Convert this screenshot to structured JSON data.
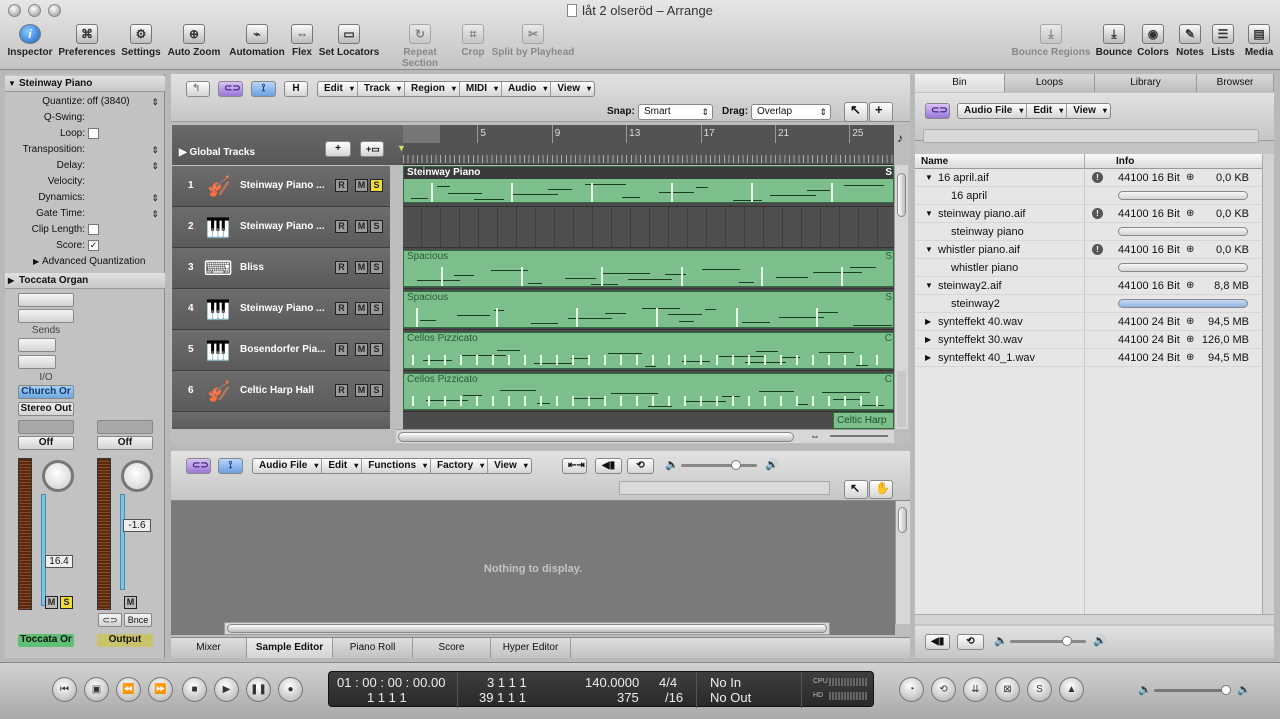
{
  "window": {
    "title": "låt 2 olseröd – Arrange"
  },
  "toolbar": {
    "left": [
      {
        "label": "Inspector",
        "icon": "info-icon"
      },
      {
        "label": "Preferences",
        "icon": "preferences-icon"
      },
      {
        "label": "Settings",
        "icon": "settings-icon"
      },
      {
        "label": "Auto Zoom",
        "icon": "zoom-icon"
      },
      {
        "label": "Automation",
        "icon": "automation-icon"
      },
      {
        "label": "Flex",
        "icon": "flex-icon"
      },
      {
        "label": "Set Locators",
        "icon": "locators-icon"
      },
      {
        "label": "Repeat Section",
        "icon": "repeat-icon"
      },
      {
        "label": "Crop",
        "icon": "crop-icon"
      },
      {
        "label": "Split by Playhead",
        "icon": "split-icon"
      }
    ],
    "right": [
      {
        "label": "Bounce Regions",
        "icon": "bounce-regions-icon"
      },
      {
        "label": "Bounce",
        "icon": "bounce-icon"
      },
      {
        "label": "Colors",
        "icon": "colors-icon"
      },
      {
        "label": "Notes",
        "icon": "notes-icon"
      },
      {
        "label": "Lists",
        "icon": "lists-icon"
      },
      {
        "label": "Media",
        "icon": "media-icon"
      }
    ]
  },
  "inspector": {
    "region_header": "Steinway Piano",
    "params": [
      {
        "key": "Quantize:",
        "value": "off (3840)"
      },
      {
        "key": "Q-Swing:",
        "value": ""
      },
      {
        "key": "Loop:",
        "value": ""
      },
      {
        "key": "Transposition:",
        "value": ""
      },
      {
        "key": "Delay:",
        "value": ""
      },
      {
        "key": "Velocity:",
        "value": ""
      },
      {
        "key": "Dynamics:",
        "value": ""
      },
      {
        "key": "Gate Time:",
        "value": ""
      },
      {
        "key": "Clip Length:",
        "value": ""
      },
      {
        "key": "Score:",
        "value": "✓"
      }
    ],
    "advanced": "Advanced Quantization",
    "track_header": "Toccata Organ",
    "sends_label": "Sends",
    "io_label": "I/O",
    "input_label": "Church Or",
    "output_label": "Stereo Out",
    "auto1": "Off",
    "auto2": "Off",
    "vol1": "16.4",
    "vol2": "-1.6",
    "m_label": "M",
    "s_label": "S",
    "bnce_label": "Bnce",
    "ch1_name": "Toccata Or",
    "ch2_name": "Output"
  },
  "arrange": {
    "menus": [
      "Edit",
      "Track",
      "Region",
      "MIDI",
      "Audio",
      "View"
    ],
    "h_label": "H",
    "snap_label": "Snap:",
    "snap_value": "Smart",
    "drag_label": "Drag:",
    "drag_value": "Overlap",
    "global_tracks": "Global Tracks",
    "ruler": [
      "1",
      "5",
      "9",
      "13",
      "17",
      "21",
      "25"
    ],
    "tracks": [
      {
        "num": "1",
        "name": "Steinway Piano ...",
        "icon": "violin-icon",
        "solo": true,
        "region": "Steinway Piano",
        "has_region": true
      },
      {
        "num": "2",
        "name": "Steinway Piano ...",
        "icon": "grand-piano-icon",
        "solo": false,
        "region": "",
        "has_region": false
      },
      {
        "num": "3",
        "name": "Bliss",
        "icon": "keyboard-icon",
        "solo": false,
        "region": "Spacious",
        "has_region": true
      },
      {
        "num": "4",
        "name": "Steinway Piano ...",
        "icon": "grand-piano-icon",
        "solo": false,
        "region": "Spacious",
        "has_region": true
      },
      {
        "num": "5",
        "name": "Bosendorfer Pia...",
        "icon": "grand-piano-icon",
        "solo": false,
        "region": "Cellos Pizzicato",
        "has_region": true
      },
      {
        "num": "6",
        "name": "Celtic Harp Hall",
        "icon": "violin-icon",
        "solo": false,
        "region": "Cellos Pizzicato",
        "has_region": true
      }
    ],
    "partial_region": "Celtic Harp",
    "region_end_s": "S",
    "region_end_c": "C",
    "r_label": "R",
    "m_label": "M",
    "s_label": "S"
  },
  "editor": {
    "menus": [
      "Audio File",
      "Edit",
      "Functions",
      "Factory",
      "View"
    ],
    "empty_text": "Nothing to display.",
    "tabs": [
      "Mixer",
      "Sample Editor",
      "Piano Roll",
      "Score",
      "Hyper Editor"
    ],
    "active_tab": "Sample Editor"
  },
  "bin": {
    "tabs": [
      "Bin",
      "Loops",
      "Library",
      "Browser"
    ],
    "menus": [
      "Audio File",
      "Edit",
      "View"
    ],
    "col_name": "Name",
    "col_info": "Info",
    "rows": [
      {
        "name": "16 april.aif",
        "type": "file",
        "open": true,
        "warn": true,
        "info": "44100 16 Bit",
        "link": "⊕",
        "size": "0,0 KB"
      },
      {
        "name": "16 april",
        "type": "child",
        "bar": "gray"
      },
      {
        "name": "steinway piano.aif",
        "type": "file",
        "open": true,
        "warn": true,
        "info": "44100 16 Bit",
        "link": "⊕",
        "size": "0,0 KB"
      },
      {
        "name": "steinway piano",
        "type": "child",
        "bar": "gray"
      },
      {
        "name": "whistler piano.aif",
        "type": "file",
        "open": true,
        "warn": true,
        "info": "44100 16 Bit",
        "link": "⊕",
        "size": "0,0 KB"
      },
      {
        "name": "whistler piano",
        "type": "child",
        "bar": "gray"
      },
      {
        "name": "steinway2.aif",
        "type": "file",
        "open": true,
        "warn": false,
        "info": "44100 16 Bit",
        "link": "⊕",
        "size": "8,8 MB"
      },
      {
        "name": "steinway2",
        "type": "child",
        "bar": "blue"
      },
      {
        "name": "synteffekt 40.wav",
        "type": "file",
        "open": false,
        "warn": false,
        "info": "44100 24 Bit",
        "link": "⊕",
        "size": "94,5 MB"
      },
      {
        "name": "synteffekt 30.wav",
        "type": "file",
        "open": false,
        "warn": false,
        "info": "44100 24 Bit",
        "link": "⊕",
        "size": "126,0 MB"
      },
      {
        "name": "synteffekt 40_1.wav",
        "type": "file",
        "open": false,
        "warn": false,
        "info": "44100 24 Bit",
        "link": "⊕",
        "size": "94,5 MB"
      }
    ]
  },
  "transport": {
    "smpte": "01 : 00 : 00 : 00.00",
    "bars": "1   1   1   1",
    "pos1": "3   1   1   1",
    "pos2": "39   1   1   1",
    "tempo": "140.0000",
    "tempo2": "375",
    "sig": "4/4",
    "div": "/16",
    "in": "No In",
    "out": "No Out",
    "cpu": "CPU",
    "hd": "HD"
  },
  "colors": {
    "region": "#7cbf8c",
    "track_bg": "#606060",
    "selected_tab": "#e5e5e5"
  }
}
